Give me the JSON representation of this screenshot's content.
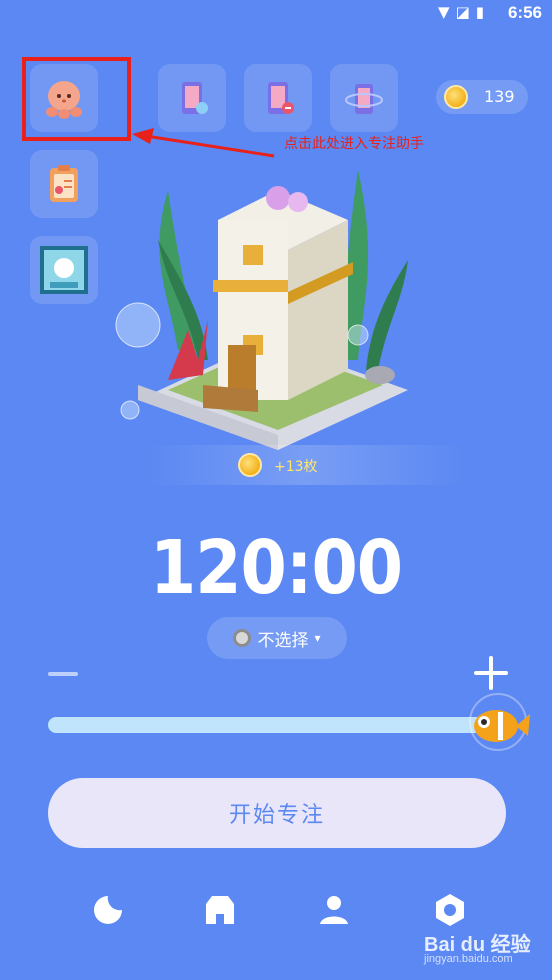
{
  "status_bar": {
    "time": "6:56",
    "icons": [
      "wifi-icon",
      "signal-icon",
      "battery-icon"
    ]
  },
  "coins": {
    "count": "139"
  },
  "annotation": {
    "text": "点击此处进入专注助手"
  },
  "reward": {
    "text": "+13枚"
  },
  "timer": {
    "value": "120:00"
  },
  "tag_select": {
    "label": "不选择"
  },
  "slider": {
    "level_fraction": 1.0
  },
  "start_button": {
    "label": "开始专注"
  },
  "watermark": {
    "brand": "Bai du 经验",
    "url": "jingyan.baidu.com"
  },
  "colors": {
    "background": "#5b88f2",
    "highlight": "#e8211b",
    "track": "#bfe4fb",
    "button": "#e8e6f8"
  },
  "nav_icons": [
    "moon-icon",
    "shop-icon",
    "profile-icon",
    "settings-icon"
  ]
}
